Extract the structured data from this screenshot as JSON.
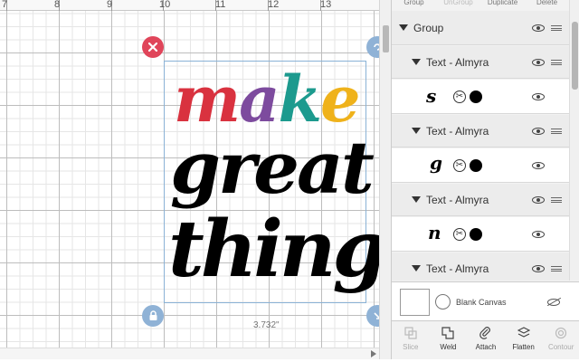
{
  "canvas": {
    "ruler": [
      "7",
      "8",
      "9",
      "10",
      "11",
      "12",
      "13"
    ],
    "artwork": {
      "line1": [
        "m",
        "a",
        "k",
        "e"
      ],
      "line1_colors": [
        "#d9323f",
        "#7d4b9e",
        "#1c9a8e",
        "#efb21b"
      ],
      "line2": "great",
      "line3": "things"
    },
    "width_readout": "3.732\""
  },
  "panel": {
    "toolbar": [
      "Group",
      "UnGroup",
      "Duplicate",
      "Delete"
    ],
    "layers": [
      {
        "type": "group",
        "label": "Group"
      },
      {
        "type": "text",
        "label": "Text - Almyra"
      },
      {
        "type": "glyph",
        "glyph": "s"
      },
      {
        "type": "text",
        "label": "Text - Almyra"
      },
      {
        "type": "glyph",
        "glyph": "g"
      },
      {
        "type": "text",
        "label": "Text - Almyra"
      },
      {
        "type": "glyph",
        "glyph": "n"
      },
      {
        "type": "text",
        "label": "Text - Almyra"
      }
    ],
    "blank_canvas_label": "Blank Canvas",
    "tools": [
      "Slice",
      "Weld",
      "Attach",
      "Flatten",
      "Contour"
    ]
  }
}
